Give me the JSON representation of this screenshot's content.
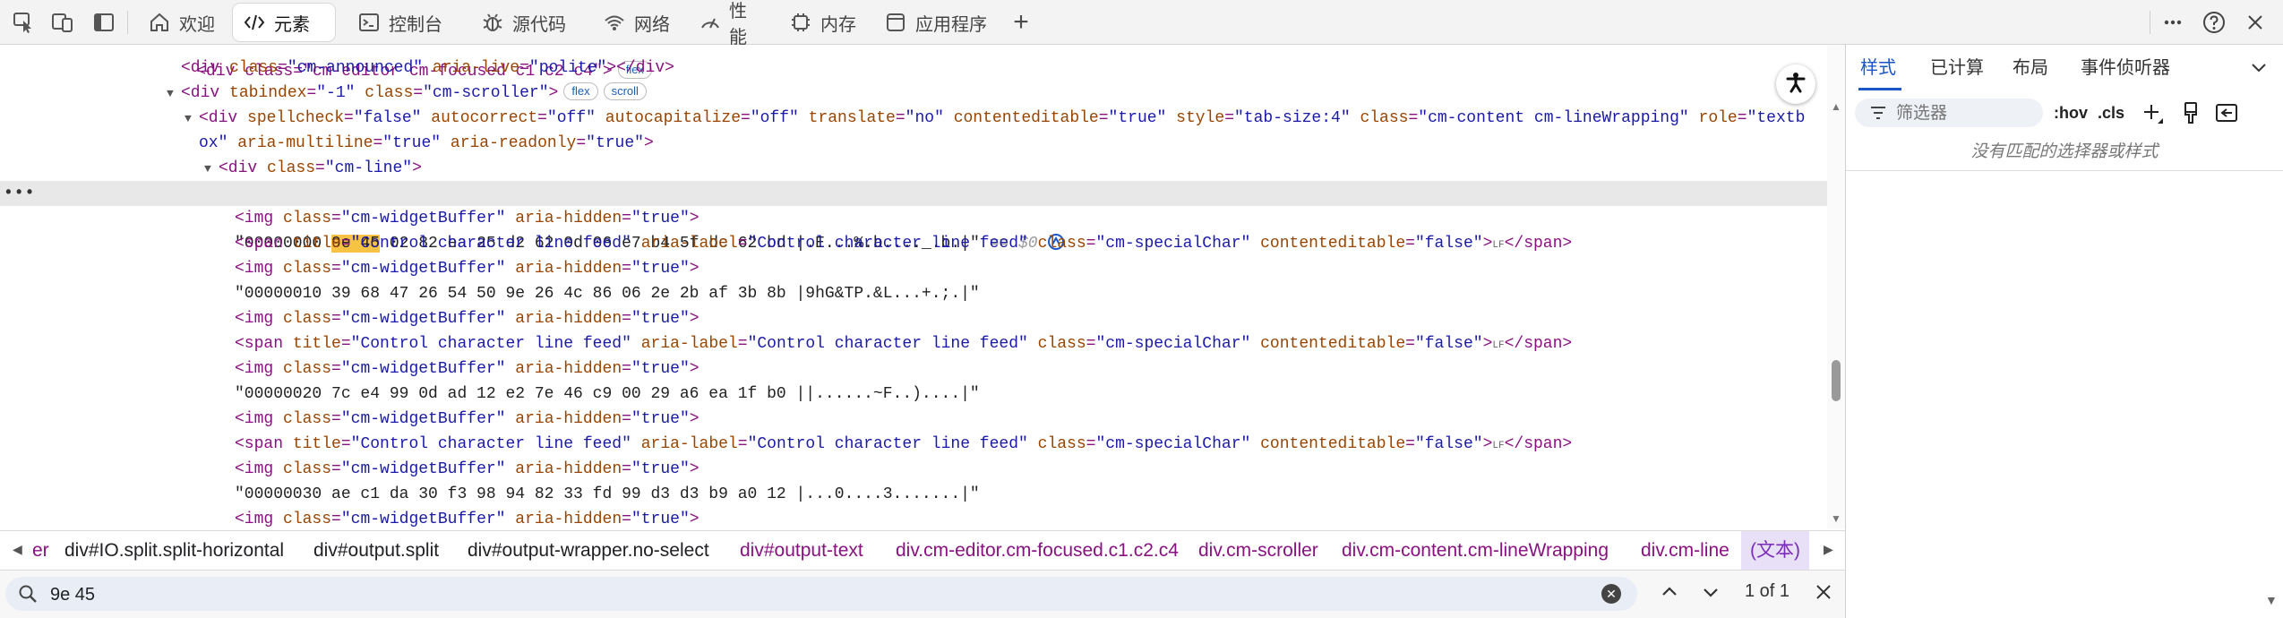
{
  "toolbar": {
    "tabs": [
      {
        "label": "欢迎",
        "icon": "home-icon"
      },
      {
        "label": "元素",
        "icon": "code-icon"
      },
      {
        "label": "控制台",
        "icon": "console-icon"
      },
      {
        "label": "源代码",
        "icon": "bug-icon"
      },
      {
        "label": "网络",
        "icon": "wifi-icon"
      },
      {
        "label": "性能",
        "icon": "gauge-icon"
      },
      {
        "label": "内存",
        "icon": "memory-icon"
      },
      {
        "label": "应用程序",
        "icon": "application-icon"
      }
    ],
    "add_tab_label": "+",
    "right_icons": [
      "more-icon",
      "help-icon",
      "close-icon"
    ]
  },
  "dom": {
    "line0": {
      "text": "<div class=\"cm-editor cm-focused c1 c2 c4\">",
      "badge": "flex"
    },
    "line1": {
      "open": "<div ",
      "attr": "class",
      "val": "\"cm-announced\"",
      "attr2": "aria-live",
      "val2": "\"polite\"",
      "close": "></div>"
    },
    "line2": {
      "open": "<div ",
      "attr": "tabindex",
      "val": "\"-1\"",
      "attr2": "class",
      "val2": "\"cm-scroller\"",
      "close": ">",
      "badges": [
        "flex",
        "scroll"
      ]
    },
    "line3": {
      "open": "<div ",
      "a1": "spellcheck",
      "v1": "\"false\"",
      "a2": "autocorrect",
      "v2": "\"off\"",
      "a3": "autocapitalize",
      "v3": "\"off\"",
      "a4": "translate",
      "v4": "\"no\"",
      "a5": "contenteditable",
      "v5": "\"true\"",
      "a6": "style",
      "v6": "\"tab-size:4\"",
      "a7": "class",
      "v7": "\"cm-content cm-lineWrapping\"",
      "a8": "role",
      "v8": "\"textb"
    },
    "line4": {
      "cont": "ox\"",
      "a1": "aria-multiline",
      "v1": "\"true\"",
      "a2": "aria-readonly",
      "v2": "\"true\"",
      "close": ">"
    },
    "line5": {
      "open": "<div ",
      "attr": "class",
      "val": "\"cm-line\"",
      "close": ">"
    },
    "selected_line": {
      "pre": "\"00000000 ",
      "match": "9e 45",
      "post": " 02 82 ea 25 d2 62 0d 06 e7 b4 5f dc 62 bd |.E...%.b...._.b.|\"",
      "eq": " == $0",
      "gutter": "•••"
    },
    "img_open": "<img ",
    "img_attr1": "class",
    "img_val1": "\"cm-widgetBuffer\"",
    "img_attr2": "aria-hidden",
    "img_val2": "\"true\"",
    "img_close": ">",
    "span_open": "<span ",
    "span_attr1": "title",
    "span_val1": "\"Control character line feed\"",
    "span_attr2": "aria-label",
    "span_val2": "\"Control character line feed\"",
    "span_attr3": "class",
    "span_val3": "\"cm-specialChar\"",
    "span_attr4": "contenteditable",
    "span_val4": "\"false\"",
    "span_close": ">",
    "span_lf": "LF",
    "span_end": "</span>",
    "text_lines": [
      "\"00000010 39 68 47 26 54 50 9e 26 4c 86 06 2e 2b af 3b 8b |9hG&TP.&L...+.;.|\"",
      "\"00000020 7c e4 99 0d ad 12 e2 7e 46 c9 00 29 a6 ea 1f b0 ||......~F..)....|\"",
      "\"00000030 ae c1 da 30 f3 98 94 82 33 fd 99 d3 d3 b9 a0 12 |...0....3.......|\""
    ]
  },
  "breadcrumbs": [
    {
      "label": "er",
      "kind": "tag"
    },
    {
      "label": "div#IO.split.split-horizontal",
      "kind": "plain"
    },
    {
      "label": "div#output.split",
      "kind": "plain"
    },
    {
      "label": "div#output-wrapper.no-select",
      "kind": "plain"
    },
    {
      "label": "div#output-text",
      "kind": "tag"
    },
    {
      "label": "div.cm-editor.cm-focused.c1.c2.c4",
      "kind": "tag"
    },
    {
      "label": "div.cm-scroller",
      "kind": "tag"
    },
    {
      "label": "div.cm-content.cm-lineWrapping",
      "kind": "tag"
    },
    {
      "label": "div.cm-line",
      "kind": "tag"
    },
    {
      "label": "(文本)",
      "kind": "active"
    }
  ],
  "search": {
    "value": "9e 45",
    "match_count": "1 of 1"
  },
  "styles_pane": {
    "tabs": [
      "样式",
      "已计算",
      "布局",
      "事件侦听器"
    ],
    "filter_placeholder": "筛选器",
    "hov_label": ":hov",
    "cls_label": ".cls",
    "empty_message": "没有匹配的选择器或样式"
  }
}
